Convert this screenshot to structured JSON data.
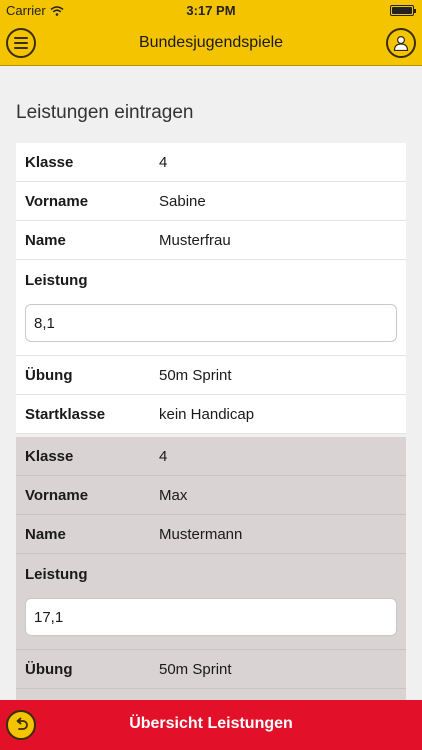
{
  "status_bar": {
    "carrier": "Carrier",
    "time": "3:17 PM"
  },
  "nav": {
    "title": "Bundesjugendspiele"
  },
  "page": {
    "section_title": "Leistungen eintragen"
  },
  "entries": [
    {
      "klasse_label": "Klasse",
      "klasse": "4",
      "vorname_label": "Vorname",
      "vorname": "Sabine",
      "name_label": "Name",
      "name": "Musterfrau",
      "leistung_label": "Leistung",
      "leistung": "8,1",
      "uebung_label": "Übung",
      "uebung": "50m Sprint",
      "startklasse_label": "Startklasse",
      "startklasse": "kein Handicap"
    },
    {
      "klasse_label": "Klasse",
      "klasse": "4",
      "vorname_label": "Vorname",
      "vorname": "Max",
      "name_label": "Name",
      "name": "Mustermann",
      "leistung_label": "Leistung",
      "leistung": "17,1",
      "uebung_label": "Übung",
      "uebung": "50m Sprint"
    }
  ],
  "bottom_bar": {
    "label": "Übersicht Leistungen"
  },
  "colors": {
    "nav": "#f4c400",
    "bottom": "#e3102a",
    "grey_card": "#d9d3d3"
  },
  "icons": {
    "menu": "menu-icon",
    "user": "user-icon",
    "back": "back-arrow-icon",
    "wifi": "wifi-icon"
  }
}
